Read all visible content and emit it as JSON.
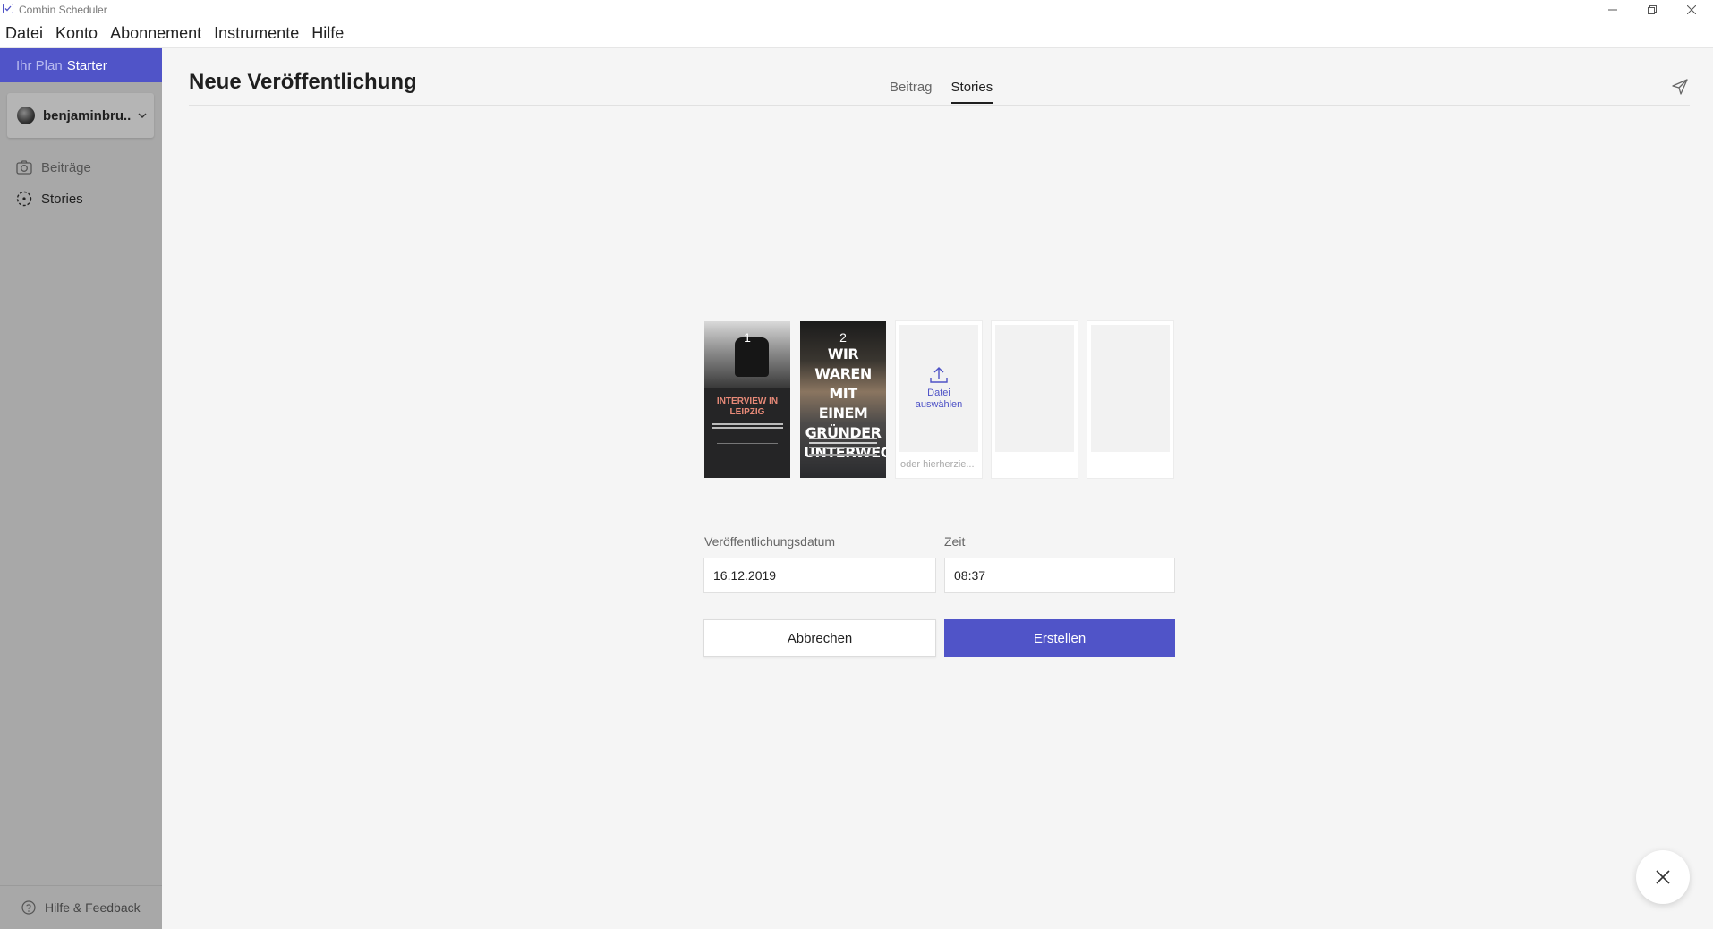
{
  "window": {
    "title": "Combin Scheduler"
  },
  "menu": [
    "Datei",
    "Konto",
    "Abonnement",
    "Instrumente",
    "Hilfe"
  ],
  "sidebar": {
    "plan_label": "Ihr Plan",
    "plan_value": "Starter",
    "account_name": "benjaminbru...",
    "items": [
      {
        "label": "Beiträge",
        "icon": "camera-icon"
      },
      {
        "label": "Stories",
        "icon": "stories-icon"
      }
    ],
    "help_label": "Hilfe & Feedback"
  },
  "main": {
    "title": "Neue Veröffentlichung",
    "tabs": [
      {
        "label": "Beitrag",
        "active": false
      },
      {
        "label": "Stories",
        "active": true
      }
    ],
    "stories": [
      {
        "number": "1",
        "headline": "INTERVIEW IN LEIPZIG"
      },
      {
        "number": "2",
        "headline": "WIR WAREN MIT EINEM GRÜNDER UNTERWEGS"
      }
    ],
    "upload": {
      "label": "Datei auswählen",
      "hint": "oder hierherzie..."
    },
    "date_label": "Veröffentlichungsdatum",
    "date_value": "16.12.2019",
    "time_label": "Zeit",
    "time_value": "08:37",
    "cancel_label": "Abbrechen",
    "create_label": "Erstellen"
  },
  "colors": {
    "accent": "#5054c8",
    "sidebar": "#a8a8a8",
    "background": "#f5f5f5"
  }
}
